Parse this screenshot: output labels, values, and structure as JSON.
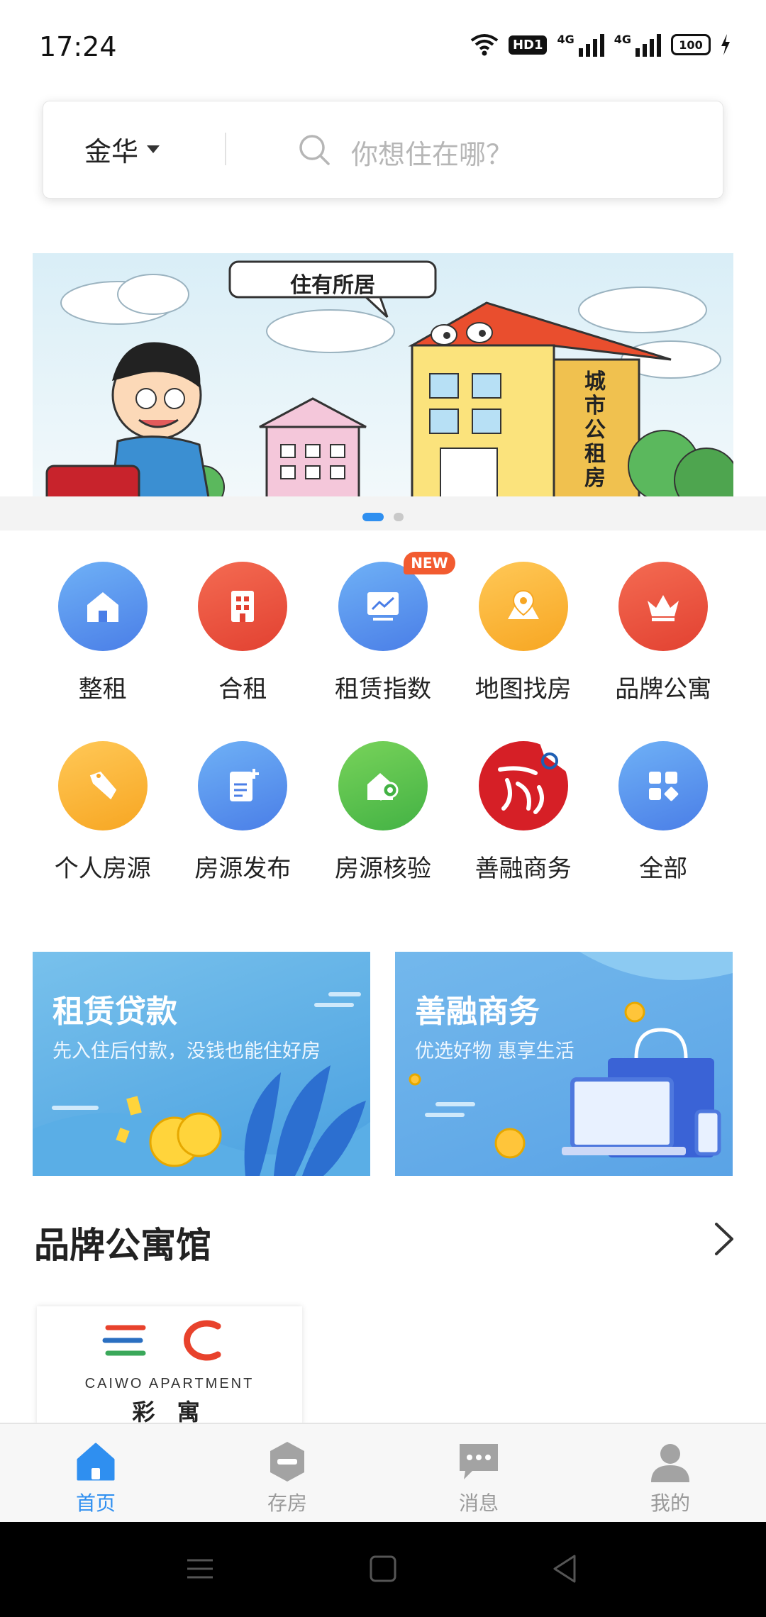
{
  "status_bar": {
    "time": "17:24",
    "hd_badge": "HD1",
    "network_1": "4G",
    "network_2": "4G",
    "battery": "100",
    "icons": [
      "wifi-icon",
      "hd-icon",
      "signal-icon",
      "signal-icon",
      "battery-icon",
      "charging-icon"
    ]
  },
  "search": {
    "city": "金华",
    "placeholder": "你想住在哪？"
  },
  "banner": {
    "caption": "住有所居",
    "building_text": "城市公租房",
    "slide_count": 2,
    "active_slide": 1
  },
  "quick_menu": [
    {
      "label": "整租",
      "icon": "house-icon",
      "color": "#5b92ec"
    },
    {
      "label": "合租",
      "icon": "building-icon",
      "color": "#ea503d"
    },
    {
      "label": "租赁指数",
      "icon": "chart-board-icon",
      "color": "#5b92ec",
      "badge": "NEW"
    },
    {
      "label": "地图找房",
      "icon": "map-pin-icon",
      "color": "#f9b43a"
    },
    {
      "label": "品牌公寓",
      "icon": "crown-icon",
      "color": "#ea503d"
    },
    {
      "label": "个人房源",
      "icon": "tag-icon",
      "color": "#f9b43a"
    },
    {
      "label": "房源发布",
      "icon": "document-add-icon",
      "color": "#5b92ec"
    },
    {
      "label": "房源核验",
      "icon": "house-key-icon",
      "color": "#55c04d"
    },
    {
      "label": "善融商务",
      "icon": "shanrong-logo-icon",
      "color": "#d61f26"
    },
    {
      "label": "全部",
      "icon": "grid-apps-icon",
      "color": "#5b92ec"
    }
  ],
  "promos": [
    {
      "title": "租赁贷款",
      "subtitle": "先入住后付款，没钱也能住好房"
    },
    {
      "title": "善融商务",
      "subtitle": "优选好物 惠享生活"
    }
  ],
  "section": {
    "title": "品牌公寓馆"
  },
  "brand_card": {
    "name_en": "CAIWO APARTMENT",
    "name_cn": "彩 寓"
  },
  "tabbar": [
    {
      "label": "首页",
      "icon": "home-icon",
      "active": true
    },
    {
      "label": "存房",
      "icon": "deposit-house-icon",
      "active": false
    },
    {
      "label": "消息",
      "icon": "message-icon",
      "active": false
    },
    {
      "label": "我的",
      "icon": "profile-icon",
      "active": false
    }
  ],
  "colors": {
    "accent": "#2f8ff0",
    "tab_inactive": "#9a9a9a"
  }
}
